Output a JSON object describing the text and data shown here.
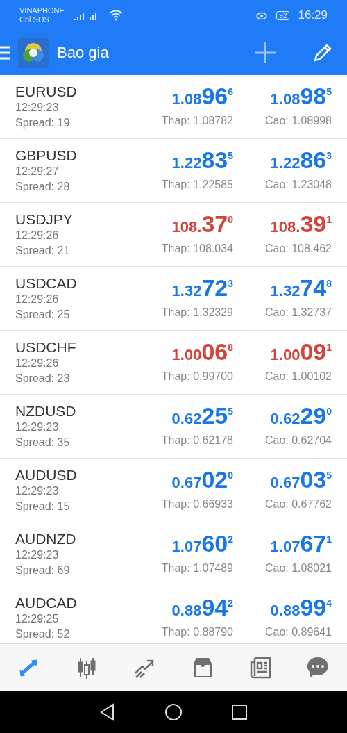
{
  "status_bar": {
    "carrier": "VINAPHONE",
    "carrier_note": "Chỉ SOS",
    "battery": "92",
    "time": "16:29"
  },
  "app_bar": {
    "title": "Bao gia"
  },
  "quotes": [
    {
      "symbol": "EURUSD",
      "time": "12:29:23",
      "spread": "Spread: 19",
      "color": "#1a78e6",
      "bid": "1.08**96**$^{6}$",
      "ask": "1.08**98**$^{5}$",
      "low": "Thap: 1.08782",
      "high": "Cao: 1.08998"
    },
    {
      "symbol": "GBPUSD",
      "time": "12:29:27",
      "spread": "Spread: 28",
      "color": "#1a78e6",
      "bid": "1.22**83**$^{5}$",
      "ask": "1.22**86**$^{3}$",
      "low": "Thap: 1.22585",
      "high": "Cao: 1.23048"
    },
    {
      "symbol": "USDJPY",
      "time": "12:29:26",
      "spread": "Spread: 21",
      "color": "#d2453c",
      "bid": "108.**37**$^{0}$",
      "ask": "108.**39**$^{1}$",
      "low": "Thap: 108.034",
      "high": "Cao: 108.462"
    },
    {
      "symbol": "USDCAD",
      "time": "12:29:26",
      "spread": "Spread: 25",
      "color": "#1a78e6",
      "bid": "1.32**72**$^{3}$",
      "ask": "1.32**74**$^{8}$",
      "low": "Thap: 1.32329",
      "high": "Cao: 1.32737"
    },
    {
      "symbol": "USDCHF",
      "time": "12:29:26",
      "spread": "Spread: 23",
      "color": "#d2453c",
      "bid": "1.00**06**$^{8}$",
      "ask": "1.00**09**$^{1}$",
      "low": "Thap: 0.99700",
      "high": "Cao: 1.00102"
    },
    {
      "symbol": "NZDUSD",
      "time": "12:29:23",
      "spread": "Spread: 35",
      "color": "#1a78e6",
      "bid": "0.62**25**$^{5}$",
      "ask": "0.62**29**$^{0}$",
      "low": "Thap: 0.62178",
      "high": "Cao: 0.62704"
    },
    {
      "symbol": "AUDUSD",
      "time": "12:29:23",
      "spread": "Spread: 15",
      "color": "#1a78e6",
      "bid": "0.67**02**$^{0}$",
      "ask": "0.67**03**$^{5}$",
      "low": "Thap: 0.66933",
      "high": "Cao: 0.67762"
    },
    {
      "symbol": "AUDNZD",
      "time": "12:29:23",
      "spread": "Spread: 69",
      "color": "#1a78e6",
      "bid": "1.07**60**$^{2}$",
      "ask": "1.07**67**$^{1}$",
      "low": "Thap: 1.07489",
      "high": "Cao: 1.08021"
    },
    {
      "symbol": "AUDCAD",
      "time": "12:29:25",
      "spread": "Spread: 52",
      "color": "#1a78e6",
      "bid": "0.88**94**$^{2}$",
      "ask": "0.88**99**$^{4}$",
      "low": "Thap: 0.88790",
      "high": "Cao: 0.89641"
    }
  ],
  "bottom_nav": [
    {
      "kind": "quotes",
      "selected": true
    },
    {
      "kind": "chart",
      "selected": false
    },
    {
      "kind": "trade",
      "selected": false
    },
    {
      "kind": "history",
      "selected": false
    },
    {
      "kind": "news",
      "selected": false
    },
    {
      "kind": "chat",
      "selected": false
    }
  ]
}
